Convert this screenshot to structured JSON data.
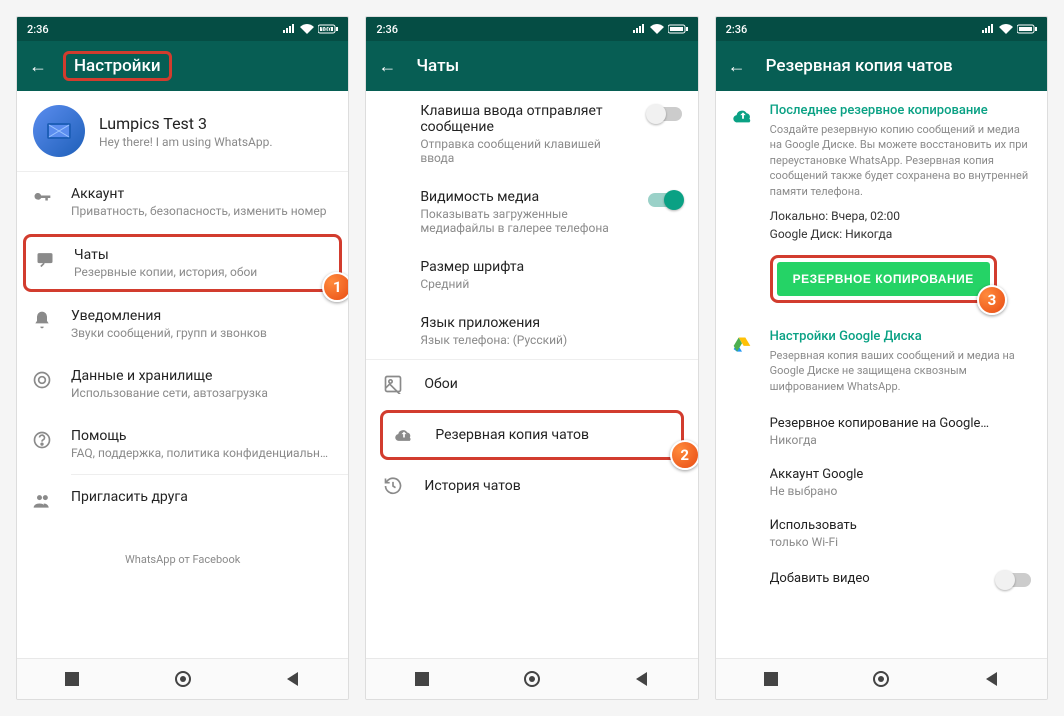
{
  "status": {
    "time": "2:36"
  },
  "screens": [
    {
      "title": "Настройки",
      "title_highlighted": true,
      "profile": {
        "name": "Lumpics Test 3",
        "status": "Hey there! I am using WhatsApp."
      },
      "items": [
        {
          "icon": "key",
          "title": "Аккаунт",
          "sub": "Приватность, безопасность, изменить номер"
        },
        {
          "icon": "chat",
          "title": "Чаты",
          "sub": "Резервные копии, история, обои",
          "highlighted": true,
          "badge": "1"
        },
        {
          "icon": "bell",
          "title": "Уведомления",
          "sub": "Звуки сообщений, групп и звонков"
        },
        {
          "icon": "data",
          "title": "Данные и хранилище",
          "sub": "Использование сети, автозагрузка"
        },
        {
          "icon": "help",
          "title": "Помощь",
          "sub": "FAQ, поддержка, политика конфиденциально..."
        },
        {
          "icon": "invite",
          "title": "Пригласить друга",
          "sub": ""
        }
      ],
      "footer": "WhatsApp от Facebook"
    },
    {
      "title": "Чаты",
      "settings": [
        {
          "title": "Клавиша ввода отправляет сообщение",
          "sub": "Отправка сообщений клавишей ввода",
          "toggle": "off"
        },
        {
          "title": "Видимость медиа",
          "sub": "Показывать загруженные медиафайлы в галерее телефона",
          "toggle": "on"
        },
        {
          "title": "Размер шрифта",
          "sub": "Средний"
        },
        {
          "title": "Язык приложения",
          "sub": "Язык телефона: (Русский)"
        }
      ],
      "actions": [
        {
          "icon": "wallpaper",
          "title": "Обои"
        },
        {
          "icon": "cloud",
          "title": "Резервная копия чатов",
          "highlighted": true,
          "badge": "2"
        },
        {
          "icon": "history",
          "title": "История чатов"
        }
      ]
    },
    {
      "title": "Резервная копия чатов",
      "backup_section": {
        "heading": "Последнее резервное копирование",
        "desc": "Создайте резервную копию сообщений и медиа на Google Диске. Вы можете восстановить их при переустановке WhatsApp. Резервная копия сообщений также будет сохранена во внутренней памяти телефона.",
        "local": "Локально: Вчера, 02:00",
        "gdrive": "Google Диск: Никогда",
        "button": "РЕЗЕРВНОЕ КОПИРОВАНИЕ",
        "badge": "3"
      },
      "gdrive_section": {
        "heading": "Настройки Google Диска",
        "desc": "Резервная копия ваших сообщений и медиа на Google Диске не защищена сквозным шифрованием WhatsApp.",
        "items": [
          {
            "title": "Резервное копирование на Google…",
            "sub": "Никогда"
          },
          {
            "title": "Аккаунт Google",
            "sub": "Не выбрано"
          },
          {
            "title": "Использовать",
            "sub": "только Wi-Fi"
          },
          {
            "title": "Добавить видео",
            "toggle": "off"
          }
        ]
      }
    }
  ]
}
